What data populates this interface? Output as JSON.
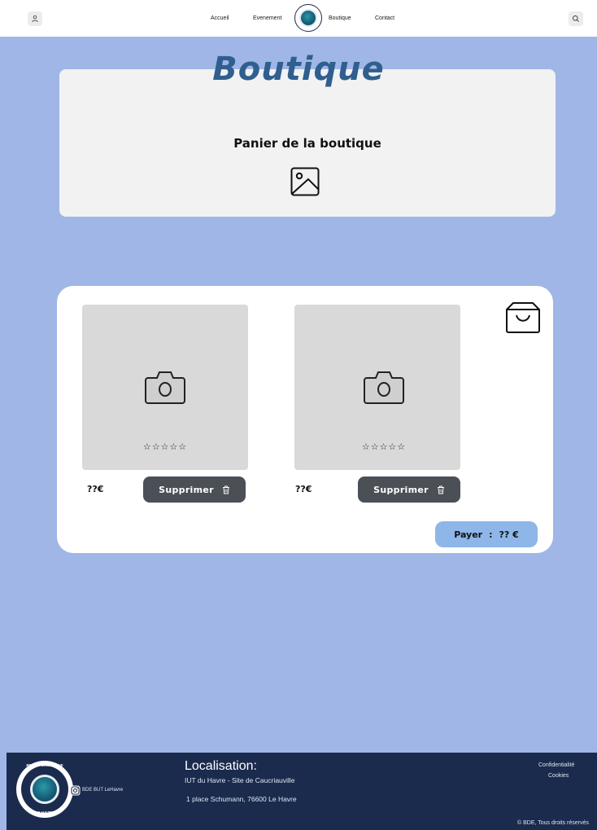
{
  "navbar": {
    "links": [
      "Accueil",
      "Evenement",
      "Boutique",
      "Contact"
    ],
    "user_icon": "user-icon",
    "search_icon": "search-icon",
    "logo_icon": "bde-logo-icon"
  },
  "hero": {
    "title": "Boutique",
    "subtitle": "Panier de la boutique",
    "image_icon": "image-placeholder-icon"
  },
  "cart": {
    "bag_icon": "shopping-bag-icon",
    "products": [
      {
        "stars": "☆☆☆☆☆",
        "price": "??€",
        "delete_label": "Supprimer",
        "image_icon": "camera-icon"
      },
      {
        "stars": "☆☆☆☆☆",
        "price": "??€",
        "delete_label": "Supprimer",
        "image_icon": "camera-icon"
      }
    ],
    "pay": {
      "label": "Payer",
      "separator": ":",
      "amount": "?? €"
    }
  },
  "footer": {
    "logo_text_top": "BDE INFORMATIQUE",
    "logo_text_bottom": "LE HAVRE",
    "instagram_label": "BDE BUT LeHavre",
    "location_title": "Localisation:",
    "location_line1": "IUT du Havre - Site de Caucriauville",
    "location_line2": "1 place Schumann, 76600 Le Havre",
    "links": [
      "Confidentialité",
      "Cookies"
    ],
    "copyright": "© BDE, Tous droits réservés"
  },
  "colors": {
    "background": "#a0b6e6",
    "title": "#2f5f8e",
    "footer": "#1a2b4e",
    "delete_button": "#4b5057",
    "pay_button": "#8eb6e8"
  }
}
